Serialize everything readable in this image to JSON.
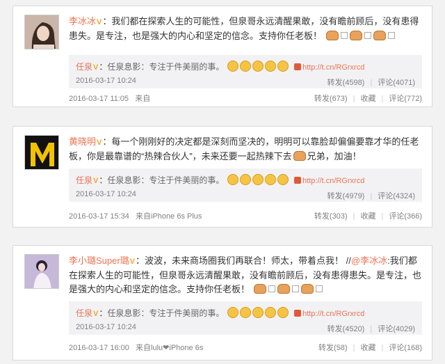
{
  "posts": [
    {
      "author": "李冰冰",
      "text": "：我们都在探索人生的可能性，但泉哥永远清醒果敢，没有瞻前顾后，没有患得患失。是专注，也是强大的内心和坚定的信念。支持你任老板！",
      "quote": {
        "author": "任泉",
        "desc": "任泉息影：专注于件美丽的事。",
        "link": "http://t.cn/RGrxrcd",
        "time": "2016-03-17 10:24",
        "repost": "转发(4598)",
        "comment": "评论(4071)"
      },
      "time": "2016-03-17 11:05",
      "source": "来自",
      "repost": "转发(673)",
      "fav": "收藏",
      "comment": "评论(772)"
    },
    {
      "author": "黄晓明",
      "text": "：每一个刚刚好的决定都是深刻而坚决的，明明可以靠脸却偏偏要靠才华的任老板，你是最靠谱的“热辣合伙人”，未来还要一起热辣下去",
      "text_tail": "兄弟，加油！",
      "quote": {
        "author": "任泉",
        "desc": "任泉息影：专注于件美丽的事。",
        "link": "http://t.cn/RGrxrcd",
        "time": "2016-03-17 10:24",
        "repost": "转发(4979)",
        "comment": "评论(4324)"
      },
      "time": "2016-03-17 15:34",
      "source": "来自iPhone 6s Plus",
      "repost": "转发(303)",
      "fav": "收藏",
      "comment": "评论(366)"
    },
    {
      "author": "李小璐Super璐",
      "text": "：波波，未来商场圈我们再联合！师太，带着点我！ //",
      "mention": "@李冰冰",
      "text_tail": ":我们都在探索人生的可能性，但泉哥永远清醒果敢，没有瞻前顾后，没有患得患失。是专注，也是强大的内心和坚定的信念。支持你任老板！",
      "quote": {
        "author": "任泉",
        "desc": "任泉息影：专注于件美丽的事。",
        "link": "http://t.cn/RGrxrcd",
        "time": "2016-03-17 10:24",
        "repost": "转发(4520)",
        "comment": "评论(4029)"
      },
      "time": "2016-03-17 16:00",
      "source": "来自lulu❤iPhone 6s",
      "repost": "转发(58)",
      "fav": "收藏",
      "comment": "评论(168)"
    }
  ],
  "colors": {
    "accent": "#eb7350",
    "meta": "#808080",
    "quote_bg": "#f2f2f5"
  }
}
